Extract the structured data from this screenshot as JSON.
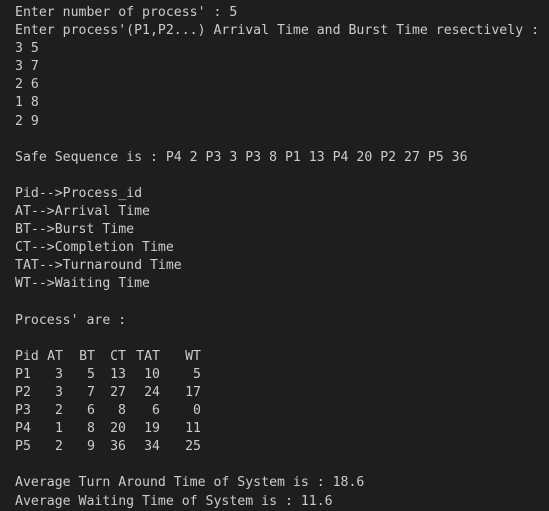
{
  "terminal": {
    "partial_top_line": "  ·  ·  ·  ·  ·  ·  ·  ·  ·  ·  ·  ·  ·  ·  ·  ·  ·  ·  ·  ·  ·  ·  ·  ·",
    "prompt_count": "Enter number of process' : 5",
    "prompt_times": "Enter process'(P1,P2...) Arrival Time and Burst Time resectively :",
    "inputs": [
      "3 5",
      "3 7",
      "2 6",
      "1 8",
      "2 9"
    ],
    "safe_sequence": "Safe Sequence is : P4 2 P3 3 P3 8 P1 13 P4 20 P2 27 P5 36",
    "legend": [
      "Pid-->Process_id",
      "AT-->Arrival Time",
      "BT-->Burst Time",
      "CT-->Completion Time",
      "TAT-->Turnaround Time",
      "WT-->Waiting Time"
    ],
    "process_heading": "Process' are :",
    "table": {
      "headers": [
        "Pid",
        "AT",
        "BT",
        "CT",
        "TAT",
        "WT"
      ],
      "rows": [
        [
          "P1",
          "3",
          "5",
          "13",
          "10",
          "5"
        ],
        [
          "P2",
          "3",
          "7",
          "27",
          "24",
          "17"
        ],
        [
          "P3",
          "2",
          "6",
          "8",
          "6",
          "0"
        ],
        [
          "P4",
          "1",
          "8",
          "20",
          "19",
          "11"
        ],
        [
          "P5",
          "2",
          "9",
          "36",
          "34",
          "25"
        ]
      ]
    },
    "avg_tat": "Average Turn Around Time of System is : 18.6",
    "avg_wt": "Average Waiting Time of System is : 11.6"
  },
  "colors": {
    "background": "#1e1e1e",
    "text": "#cccccc"
  }
}
